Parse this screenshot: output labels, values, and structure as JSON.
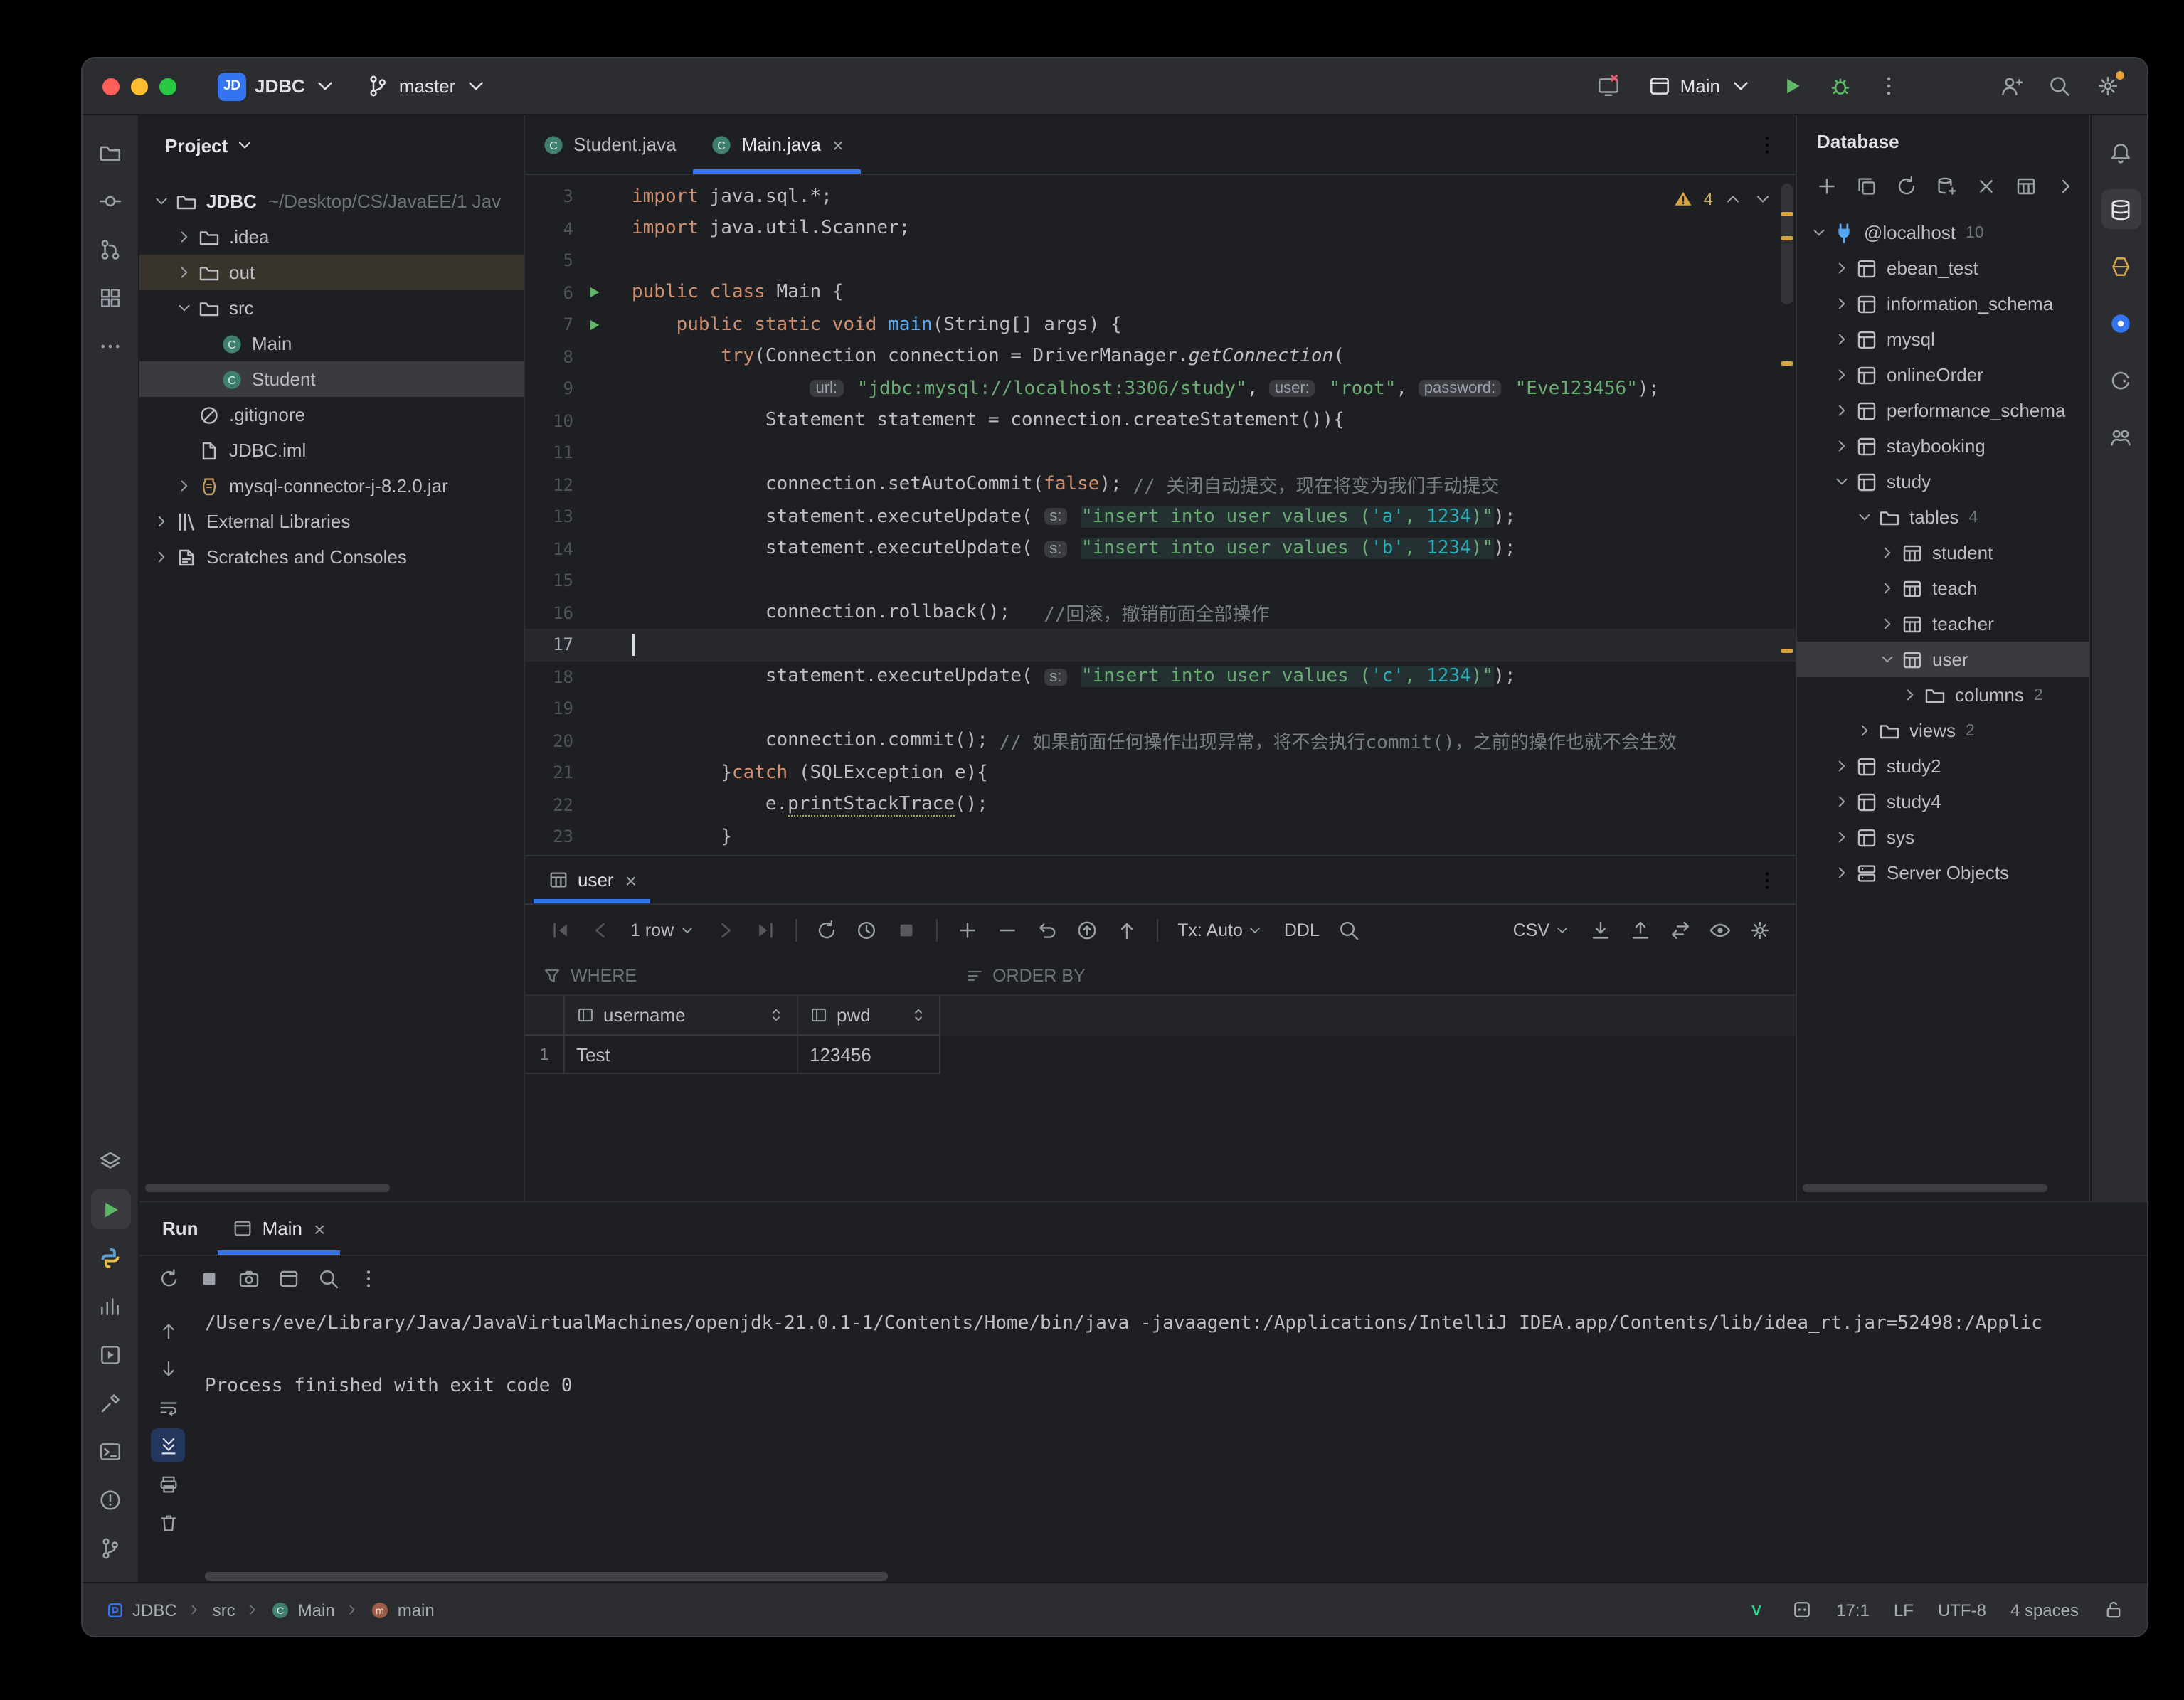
{
  "titlebar": {
    "project_badge": "JD",
    "project_name": "JDBC",
    "branch": "master",
    "run_config": "Main"
  },
  "left_strip": {
    "top": [
      "project-folder",
      "commit",
      "pull-requests",
      "structure",
      "more"
    ],
    "bottom": [
      "layers",
      "run",
      "python-console",
      "profiler",
      "services",
      "build",
      "terminal",
      "problems",
      "version-control"
    ],
    "active": "run"
  },
  "right_strip": {
    "items": [
      "notifications",
      "database",
      "beehive",
      "dependencies",
      "gradle",
      "collaboration"
    ],
    "active": "database"
  },
  "project_panel": {
    "title": "Project",
    "tree": [
      {
        "depth": 0,
        "chev": "down",
        "icon": "folder",
        "label": "JDBC",
        "suffix": "~/Desktop/CS/JavaEE/1 Jav",
        "bold": true
      },
      {
        "depth": 1,
        "chev": "right",
        "icon": "folder",
        "label": ".idea"
      },
      {
        "depth": 1,
        "chev": "right",
        "icon": "folder",
        "label": "out",
        "hl": "brown"
      },
      {
        "depth": 1,
        "chev": "down",
        "icon": "folder",
        "label": "src"
      },
      {
        "depth": 2,
        "icon": "class",
        "label": "Main"
      },
      {
        "depth": 2,
        "icon": "class",
        "label": "Student",
        "hl": "sel"
      },
      {
        "depth": 1,
        "icon": "gitignore",
        "label": ".gitignore"
      },
      {
        "depth": 1,
        "icon": "file",
        "label": "JDBC.iml"
      },
      {
        "depth": 1,
        "chev": "right",
        "icon": "jar",
        "label": "mysql-connector-j-8.2.0.jar"
      },
      {
        "depth": 0,
        "chev": "right",
        "icon": "ext-lib",
        "label": "External Libraries"
      },
      {
        "depth": 0,
        "chev": "right",
        "icon": "scratches",
        "label": "Scratches and Consoles"
      }
    ]
  },
  "editor": {
    "tabs": [
      {
        "label": "Student.java"
      },
      {
        "label": "Main.java",
        "active": true
      }
    ],
    "warning_count": "4",
    "lines": [
      {
        "n": 3,
        "s": [
          [
            "kw",
            "import"
          ],
          [
            "pl",
            " java.sql.*;"
          ]
        ]
      },
      {
        "n": 4,
        "s": [
          [
            "kw",
            "import"
          ],
          [
            "pl",
            " java.util.Scanner;"
          ]
        ]
      },
      {
        "n": 5,
        "s": []
      },
      {
        "n": 6,
        "g": "run",
        "s": [
          [
            "kw",
            "public class"
          ],
          [
            "pl",
            " Main {"
          ]
        ]
      },
      {
        "n": 7,
        "g": "run",
        "s": [
          [
            "pl",
            "    "
          ],
          [
            "kw",
            "public static void"
          ],
          [
            "pl",
            " "
          ],
          [
            "dec",
            "main"
          ],
          [
            "pl",
            "(String[] args) {"
          ]
        ]
      },
      {
        "n": 8,
        "s": [
          [
            "pl",
            "        "
          ],
          [
            "kw",
            "try"
          ],
          [
            "pl",
            "(Connection connection = DriverManager."
          ],
          [
            "ita",
            "getConnection"
          ],
          [
            "pl",
            "("
          ]
        ]
      },
      {
        "n": 9,
        "s": [
          [
            "pl",
            "                "
          ],
          [
            "hint",
            "url:"
          ],
          [
            "pl",
            " "
          ],
          [
            "str",
            "\"jdbc:mysql://localhost:3306/study\""
          ],
          [
            "pl",
            ", "
          ],
          [
            "hint",
            "user:"
          ],
          [
            "pl",
            " "
          ],
          [
            "str",
            "\"root\""
          ],
          [
            "pl",
            ", "
          ],
          [
            "hint",
            "password:"
          ],
          [
            "pl",
            " "
          ],
          [
            "str",
            "\"Eve123456\""
          ],
          [
            "pl",
            ");"
          ]
        ]
      },
      {
        "n": 10,
        "s": [
          [
            "pl",
            "            Statement statement = connection.createStatement()){"
          ]
        ]
      },
      {
        "n": 11,
        "s": []
      },
      {
        "n": 12,
        "s": [
          [
            "pl",
            "            connection.setAutoCommit("
          ],
          [
            "kw",
            "false"
          ],
          [
            "pl",
            "); "
          ],
          [
            "cmt",
            "// 关闭自动提交，现在将变为我们手动提交"
          ]
        ]
      },
      {
        "n": 13,
        "s": [
          [
            "pl",
            "            statement.executeUpdate( "
          ],
          [
            "hint",
            "s:"
          ],
          [
            "pl",
            " "
          ],
          [
            "sqls",
            "\"insert into user values ("
          ],
          [
            "sqlv",
            "'a'"
          ],
          [
            "sqls",
            ", "
          ],
          [
            "sqlv",
            "1234"
          ],
          [
            "sqls",
            ")\""
          ],
          [
            "pl",
            ");"
          ]
        ]
      },
      {
        "n": 14,
        "s": [
          [
            "pl",
            "            statement.executeUpdate( "
          ],
          [
            "hint",
            "s:"
          ],
          [
            "pl",
            " "
          ],
          [
            "sqls",
            "\"insert into user values ("
          ],
          [
            "sqlv",
            "'b'"
          ],
          [
            "sqls",
            ", "
          ],
          [
            "sqlv",
            "1234"
          ],
          [
            "sqls",
            ")\""
          ],
          [
            "pl",
            ");"
          ]
        ]
      },
      {
        "n": 15,
        "s": []
      },
      {
        "n": 16,
        "s": [
          [
            "pl",
            "            connection.rollback();   "
          ],
          [
            "cmt",
            "//回滚，撤销前面全部操作"
          ]
        ]
      },
      {
        "n": 17,
        "cur": true,
        "s": []
      },
      {
        "n": 18,
        "s": [
          [
            "pl",
            "            statement.executeUpdate( "
          ],
          [
            "hint",
            "s:"
          ],
          [
            "pl",
            " "
          ],
          [
            "sqls",
            "\"insert into user values ("
          ],
          [
            "sqlv",
            "'c'"
          ],
          [
            "sqls",
            ", "
          ],
          [
            "sqlv",
            "1234"
          ],
          [
            "sqls",
            ")\""
          ],
          [
            "pl",
            ");"
          ]
        ]
      },
      {
        "n": 19,
        "s": []
      },
      {
        "n": 20,
        "s": [
          [
            "pl",
            "            connection.commit(); "
          ],
          [
            "cmt",
            "// 如果前面任何操作出现异常，将不会执行commit()，之前的操作也就不会生效"
          ]
        ]
      },
      {
        "n": 21,
        "s": [
          [
            "pl",
            "        }"
          ],
          [
            "kw",
            "catch"
          ],
          [
            "pl",
            " (SQLException e){"
          ]
        ]
      },
      {
        "n": 22,
        "s": [
          [
            "pl",
            "            e."
          ],
          [
            "wavy",
            "printStackTrace"
          ],
          [
            "pl",
            "();"
          ]
        ]
      },
      {
        "n": 23,
        "s": [
          [
            "pl",
            "        }"
          ]
        ]
      }
    ]
  },
  "table_window": {
    "tab": "user",
    "where_label": "WHERE",
    "order_by_label": "ORDER BY",
    "toolbar_left": [
      {
        "i": "first",
        "dim": true
      },
      {
        "i": "prev",
        "dim": true
      },
      {
        "t": "1 row",
        "chev": true
      },
      {
        "i": "next",
        "dim": true
      },
      {
        "i": "last",
        "dim": true
      },
      {
        "sep": true
      },
      {
        "i": "refresh"
      },
      {
        "i": "clock"
      },
      {
        "i": "stop",
        "dim": true
      },
      {
        "sep": true
      },
      {
        "i": "plus"
      },
      {
        "i": "minus"
      },
      {
        "i": "revert"
      },
      {
        "i": "commit-up"
      },
      {
        "i": "arrow-up"
      },
      {
        "sep": true
      },
      {
        "t": "Tx: Auto",
        "chev": true
      },
      {
        "t": "DDL"
      },
      {
        "i": "search"
      }
    ],
    "toolbar_right": [
      {
        "t": "CSV",
        "chev": true
      },
      {
        "i": "download"
      },
      {
        "i": "upload"
      },
      {
        "i": "transfer"
      },
      {
        "i": "eye"
      },
      {
        "i": "gear"
      }
    ],
    "grid": {
      "columns": [
        "username",
        "pwd"
      ],
      "rows": [
        {
          "num": "1",
          "cells": [
            "Test",
            "123456"
          ]
        }
      ]
    }
  },
  "db_panel": {
    "title": "Database",
    "toolbar": [
      "add",
      "duplicate",
      "refresh",
      "datasource",
      "cancel",
      "table",
      "chevron-right"
    ],
    "tree": [
      {
        "depth": 0,
        "chev": "down",
        "icon": "plug",
        "label": "@localhost",
        "badge": "10"
      },
      {
        "depth": 1,
        "chev": "right",
        "icon": "schema",
        "label": "ebean_test"
      },
      {
        "depth": 1,
        "chev": "right",
        "icon": "schema",
        "label": "information_schema"
      },
      {
        "depth": 1,
        "chev": "right",
        "icon": "schema",
        "label": "mysql"
      },
      {
        "depth": 1,
        "chev": "right",
        "icon": "schema",
        "label": "onlineOrder"
      },
      {
        "depth": 1,
        "chev": "right",
        "icon": "schema",
        "label": "performance_schema"
      },
      {
        "depth": 1,
        "chev": "right",
        "icon": "schema",
        "label": "staybooking"
      },
      {
        "depth": 1,
        "chev": "down",
        "icon": "schema",
        "label": "study"
      },
      {
        "depth": 2,
        "chev": "down",
        "icon": "folder",
        "label": "tables",
        "badge": "4"
      },
      {
        "depth": 3,
        "chev": "right",
        "icon": "table",
        "label": "student"
      },
      {
        "depth": 3,
        "chev": "right",
        "icon": "table",
        "label": "teach"
      },
      {
        "depth": 3,
        "chev": "right",
        "icon": "table",
        "label": "teacher"
      },
      {
        "depth": 3,
        "chev": "down",
        "icon": "table",
        "label": "user",
        "hl": "sel"
      },
      {
        "depth": 4,
        "chev": "right",
        "icon": "folder",
        "label": "columns",
        "badge": "2"
      },
      {
        "depth": 2,
        "chev": "right",
        "icon": "folder",
        "label": "views",
        "badge": "2"
      },
      {
        "depth": 1,
        "chev": "right",
        "icon": "schema",
        "label": "study2"
      },
      {
        "depth": 1,
        "chev": "right",
        "icon": "schema",
        "label": "study4"
      },
      {
        "depth": 1,
        "chev": "right",
        "icon": "schema",
        "label": "sys"
      },
      {
        "depth": 1,
        "chev": "right",
        "icon": "server",
        "label": "Server Objects"
      }
    ]
  },
  "run_panel": {
    "title": "Run",
    "tab": "Main",
    "toolbar": [
      "rerun",
      "stop",
      "screenshot",
      "app-window",
      "inspect",
      "more-v"
    ],
    "vbar": [
      "arrow-up",
      "arrow-down",
      "softwrap",
      "scroll-end",
      "print",
      "trash"
    ],
    "vbar_active": "scroll-end",
    "console_lines": [
      "/Users/eve/Library/Java/JavaVirtualMachines/openjdk-21.0.1-1/Contents/Home/bin/java -javaagent:/Applications/IntelliJ IDEA.app/Contents/lib/idea_rt.jar=52498:/Applic",
      "",
      "Process finished with exit code 0"
    ]
  },
  "statusbar": {
    "breadcrumbs": [
      {
        "icon": "project-square",
        "label": "JDBC"
      },
      {
        "label": "src"
      },
      {
        "icon": "class-sm",
        "label": "Main"
      },
      {
        "icon": "method",
        "label": "main"
      }
    ],
    "right": [
      {
        "icon": "v-logo"
      },
      {
        "icon": "ai"
      },
      {
        "t": "17:1"
      },
      {
        "t": "LF"
      },
      {
        "t": "UTF-8"
      },
      {
        "t": "4 spaces"
      },
      {
        "icon": "lock-open"
      }
    ]
  },
  "colors": {
    "accent": "#3574f0",
    "run_green": "#5fb865",
    "warning": "#d9a343",
    "selection": "#393b40"
  }
}
